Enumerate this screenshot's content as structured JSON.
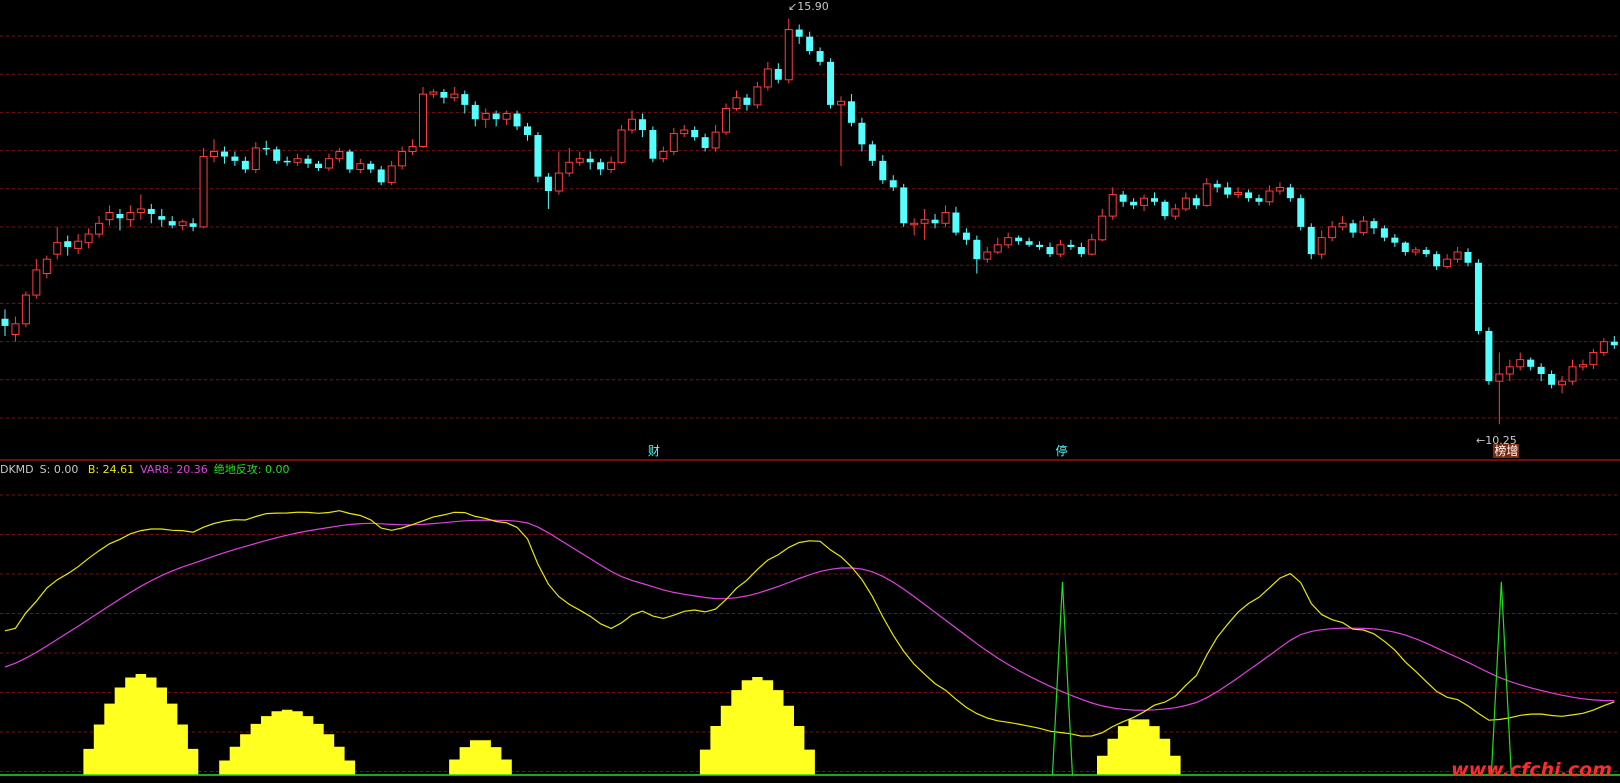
{
  "colors": {
    "background": "#000000",
    "up": "#ff3c3c",
    "down": "#54ffff",
    "grid": "#7a1010",
    "separator": "#a01010",
    "line_b": "#e8e800",
    "line_var8": "#e040e0",
    "signal_green": "#20e020",
    "fill_yellow": "#ffff20"
  },
  "price_panel": {
    "high_label": "15.90",
    "low_label": "10.25",
    "event_tags": [
      {
        "label": "财",
        "bg": "#000000",
        "fg": "#54ffff",
        "index": 62
      },
      {
        "label": "停",
        "bg": "#000000",
        "fg": "#54ffff",
        "index": 101
      },
      {
        "label": "榜增",
        "bg": "#7a2a10",
        "fg": "#ffffff",
        "index": 143
      }
    ],
    "candles": [
      [
        0,
        11.72,
        11.62,
        11.85,
        11.48
      ],
      [
        1,
        11.5,
        11.65,
        11.75,
        11.4
      ],
      [
        2,
        11.65,
        12.05,
        12.1,
        11.6
      ],
      [
        3,
        12.05,
        12.4,
        12.55,
        12.0
      ],
      [
        4,
        12.35,
        12.55,
        12.6,
        12.28
      ],
      [
        5,
        12.62,
        12.78,
        13.0,
        12.55
      ],
      [
        6,
        12.8,
        12.72,
        12.88,
        12.6
      ],
      [
        7,
        12.7,
        12.8,
        12.9,
        12.62
      ],
      [
        8,
        12.78,
        12.9,
        12.98,
        12.7
      ],
      [
        9,
        12.9,
        13.05,
        13.15,
        12.85
      ],
      [
        10,
        13.1,
        13.2,
        13.3,
        13.02
      ],
      [
        11,
        13.18,
        13.12,
        13.25,
        12.95
      ],
      [
        12,
        13.1,
        13.2,
        13.3,
        13.0
      ],
      [
        13,
        13.2,
        13.25,
        13.45,
        13.1
      ],
      [
        14,
        13.25,
        13.18,
        13.32,
        13.05
      ],
      [
        15,
        13.15,
        13.1,
        13.25,
        13.0
      ],
      [
        16,
        13.08,
        13.02,
        13.15,
        12.98
      ],
      [
        17,
        13.02,
        13.07,
        13.1,
        12.95
      ],
      [
        18,
        13.05,
        13.0,
        13.12,
        12.94
      ],
      [
        19,
        13.0,
        13.98,
        14.1,
        12.98
      ],
      [
        20,
        13.98,
        14.05,
        14.22,
        13.9
      ],
      [
        21,
        14.05,
        13.98,
        14.12,
        13.88
      ],
      [
        22,
        13.98,
        13.92,
        14.05,
        13.85
      ],
      [
        23,
        13.92,
        13.8,
        13.98,
        13.75
      ],
      [
        24,
        13.8,
        14.1,
        14.18,
        13.75
      ],
      [
        25,
        14.1,
        14.08,
        14.2,
        14.0
      ],
      [
        26,
        14.08,
        13.92,
        14.12,
        13.88
      ],
      [
        27,
        13.92,
        13.9,
        13.98,
        13.85
      ],
      [
        28,
        13.9,
        13.95,
        14.02,
        13.85
      ],
      [
        29,
        13.95,
        13.88,
        14.0,
        13.82
      ],
      [
        30,
        13.88,
        13.82,
        13.92,
        13.78
      ],
      [
        31,
        13.82,
        13.95,
        14.02,
        13.78
      ],
      [
        32,
        13.95,
        14.05,
        14.1,
        13.9
      ],
      [
        33,
        14.05,
        13.8,
        14.08,
        13.75
      ],
      [
        34,
        13.8,
        13.88,
        13.95,
        13.75
      ],
      [
        35,
        13.88,
        13.8,
        13.92,
        13.75
      ],
      [
        36,
        13.8,
        13.62,
        13.85,
        13.58
      ],
      [
        37,
        13.62,
        13.85,
        13.92,
        13.58
      ],
      [
        38,
        13.85,
        14.05,
        14.12,
        13.8
      ],
      [
        39,
        14.05,
        14.12,
        14.22,
        14.0
      ],
      [
        40,
        14.12,
        14.85,
        14.95,
        14.1
      ],
      [
        41,
        14.85,
        14.88,
        14.92,
        14.8
      ],
      [
        42,
        14.88,
        14.8,
        14.92,
        14.72
      ],
      [
        43,
        14.8,
        14.85,
        14.95,
        14.75
      ],
      [
        44,
        14.85,
        14.7,
        14.9,
        14.58
      ],
      [
        45,
        14.7,
        14.5,
        14.75,
        14.4
      ],
      [
        46,
        14.5,
        14.58,
        14.65,
        14.38
      ],
      [
        47,
        14.58,
        14.5,
        14.62,
        14.4
      ],
      [
        48,
        14.5,
        14.58,
        14.62,
        14.42
      ],
      [
        49,
        14.58,
        14.4,
        14.62,
        14.35
      ],
      [
        50,
        14.4,
        14.28,
        14.45,
        14.2
      ],
      [
        51,
        14.28,
        13.7,
        14.32,
        13.62
      ],
      [
        52,
        13.7,
        13.5,
        13.75,
        13.25
      ],
      [
        53,
        13.5,
        13.75,
        14.05,
        13.45
      ],
      [
        54,
        13.75,
        13.9,
        14.1,
        13.7
      ],
      [
        55,
        13.9,
        13.95,
        14.05,
        13.85
      ],
      [
        56,
        13.95,
        13.9,
        14.05,
        13.8
      ],
      [
        57,
        13.9,
        13.8,
        13.95,
        13.72
      ],
      [
        58,
        13.8,
        13.9,
        13.98,
        13.75
      ],
      [
        59,
        13.9,
        14.35,
        14.42,
        13.88
      ],
      [
        60,
        14.35,
        14.5,
        14.62,
        14.3
      ],
      [
        61,
        14.5,
        14.35,
        14.58,
        14.25
      ],
      [
        62,
        14.35,
        13.95,
        14.4,
        13.9
      ],
      [
        63,
        13.95,
        14.05,
        14.12,
        13.9
      ],
      [
        64,
        14.05,
        14.3,
        14.38,
        14.0
      ],
      [
        65,
        14.3,
        14.35,
        14.42,
        14.25
      ],
      [
        66,
        14.35,
        14.25,
        14.4,
        14.2
      ],
      [
        67,
        14.25,
        14.1,
        14.3,
        14.05
      ],
      [
        68,
        14.1,
        14.32,
        14.42,
        14.05
      ],
      [
        69,
        14.32,
        14.65,
        14.72,
        14.28
      ],
      [
        70,
        14.65,
        14.8,
        14.9,
        14.62
      ],
      [
        71,
        14.8,
        14.7,
        14.85,
        14.62
      ],
      [
        72,
        14.7,
        14.95,
        15.02,
        14.65
      ],
      [
        73,
        14.95,
        15.2,
        15.3,
        14.9
      ],
      [
        74,
        15.2,
        15.05,
        15.28,
        15.0
      ],
      [
        75,
        15.05,
        15.75,
        15.9,
        15.0
      ],
      [
        76,
        15.75,
        15.65,
        15.82,
        15.55
      ],
      [
        77,
        15.65,
        15.45,
        15.72,
        15.4
      ],
      [
        78,
        15.45,
        15.3,
        15.5,
        15.25
      ],
      [
        79,
        15.3,
        14.7,
        15.35,
        14.65
      ],
      [
        80,
        14.7,
        14.75,
        14.82,
        13.85
      ],
      [
        81,
        14.75,
        14.45,
        14.85,
        14.4
      ],
      [
        82,
        14.45,
        14.15,
        14.52,
        14.05
      ],
      [
        83,
        14.15,
        13.92,
        14.2,
        13.85
      ],
      [
        84,
        13.92,
        13.65,
        14.0,
        13.6
      ],
      [
        85,
        13.65,
        13.55,
        13.72,
        13.5
      ],
      [
        86,
        13.55,
        13.05,
        13.6,
        13.0
      ],
      [
        87,
        13.05,
        13.05,
        13.12,
        12.88
      ],
      [
        88,
        13.05,
        13.1,
        13.25,
        12.82
      ],
      [
        89,
        13.1,
        13.05,
        13.18,
        12.98
      ],
      [
        90,
        13.05,
        13.2,
        13.3,
        13.0
      ],
      [
        91,
        13.2,
        12.92,
        13.28,
        12.88
      ],
      [
        92,
        12.92,
        12.82,
        12.98,
        12.75
      ],
      [
        93,
        12.82,
        12.55,
        12.88,
        12.35
      ],
      [
        94,
        12.55,
        12.65,
        12.72,
        12.5
      ],
      [
        95,
        12.65,
        12.75,
        12.85,
        12.62
      ],
      [
        96,
        12.75,
        12.85,
        12.92,
        12.7
      ],
      [
        97,
        12.85,
        12.8,
        12.88,
        12.75
      ],
      [
        98,
        12.8,
        12.75,
        12.85,
        12.72
      ],
      [
        99,
        12.75,
        12.72,
        12.8,
        12.68
      ],
      [
        100,
        12.72,
        12.62,
        12.78,
        12.58
      ],
      [
        101,
        12.62,
        12.75,
        12.82,
        12.58
      ],
      [
        102,
        12.75,
        12.72,
        12.82,
        12.68
      ],
      [
        103,
        12.72,
        12.62,
        12.78,
        12.58
      ],
      [
        104,
        12.62,
        12.82,
        12.9,
        12.6
      ],
      [
        105,
        12.82,
        13.15,
        13.25,
        12.8
      ],
      [
        106,
        13.15,
        13.45,
        13.55,
        13.1
      ],
      [
        107,
        13.45,
        13.35,
        13.5,
        13.28
      ],
      [
        108,
        13.35,
        13.3,
        13.4,
        13.25
      ],
      [
        109,
        13.3,
        13.4,
        13.45,
        13.22
      ],
      [
        110,
        13.4,
        13.35,
        13.48,
        13.3
      ],
      [
        111,
        13.35,
        13.15,
        13.38,
        13.1
      ],
      [
        112,
        13.15,
        13.25,
        13.32,
        13.1
      ],
      [
        113,
        13.25,
        13.4,
        13.48,
        13.22
      ],
      [
        114,
        13.4,
        13.3,
        13.45,
        13.25
      ],
      [
        115,
        13.3,
        13.6,
        13.68,
        13.28
      ],
      [
        116,
        13.6,
        13.55,
        13.65,
        13.48
      ],
      [
        117,
        13.55,
        13.45,
        13.62,
        13.4
      ],
      [
        118,
        13.45,
        13.48,
        13.55,
        13.4
      ],
      [
        119,
        13.48,
        13.4,
        13.52,
        13.35
      ],
      [
        120,
        13.4,
        13.35,
        13.45,
        13.3
      ],
      [
        121,
        13.35,
        13.5,
        13.58,
        13.3
      ],
      [
        122,
        13.5,
        13.55,
        13.62,
        13.45
      ],
      [
        123,
        13.55,
        13.4,
        13.6,
        13.35
      ],
      [
        124,
        13.4,
        13.0,
        13.45,
        12.95
      ],
      [
        125,
        13.0,
        12.62,
        13.05,
        12.55
      ],
      [
        126,
        12.62,
        12.85,
        12.95,
        12.55
      ],
      [
        127,
        12.85,
        13.0,
        13.08,
        12.8
      ],
      [
        128,
        13.0,
        13.05,
        13.15,
        12.95
      ],
      [
        129,
        13.05,
        12.92,
        13.1,
        12.85
      ],
      [
        130,
        12.92,
        13.08,
        13.15,
        12.88
      ],
      [
        131,
        13.08,
        12.98,
        13.12,
        12.9
      ],
      [
        132,
        12.98,
        12.85,
        13.02,
        12.8
      ],
      [
        133,
        12.85,
        12.78,
        12.9,
        12.72
      ],
      [
        134,
        12.78,
        12.65,
        12.8,
        12.6
      ],
      [
        135,
        12.65,
        12.68,
        12.72,
        12.6
      ],
      [
        136,
        12.68,
        12.62,
        12.72,
        12.58
      ],
      [
        137,
        12.62,
        12.45,
        12.66,
        12.4
      ],
      [
        138,
        12.45,
        12.55,
        12.62,
        12.42
      ],
      [
        139,
        12.55,
        12.65,
        12.72,
        12.5
      ],
      [
        140,
        12.65,
        12.5,
        12.7,
        12.45
      ],
      [
        141,
        12.5,
        11.55,
        12.55,
        11.5
      ],
      [
        142,
        11.55,
        10.85,
        11.6,
        10.8
      ],
      [
        143,
        10.85,
        10.95,
        11.25,
        10.25
      ],
      [
        144,
        10.95,
        11.05,
        11.15,
        10.85
      ],
      [
        145,
        11.05,
        11.15,
        11.25,
        11.0
      ],
      [
        146,
        11.15,
        11.05,
        11.18,
        11.0
      ],
      [
        147,
        11.05,
        10.95,
        11.1,
        10.85
      ],
      [
        148,
        10.95,
        10.8,
        11.0,
        10.75
      ],
      [
        149,
        10.8,
        10.85,
        10.92,
        10.68
      ],
      [
        150,
        10.85,
        11.05,
        11.15,
        10.8
      ],
      [
        151,
        11.05,
        11.08,
        11.15,
        11.0
      ],
      [
        152,
        11.08,
        11.25,
        11.3,
        11.02
      ],
      [
        153,
        11.25,
        11.4,
        11.45,
        11.2
      ],
      [
        154,
        11.4,
        11.35,
        11.48,
        11.3
      ]
    ]
  },
  "indicator_panel": {
    "legend": {
      "name": "DKMD",
      "s_label": "S: 0.00",
      "b_label": "B: 24.61",
      "var8_label": "VAR8: 20.36",
      "jdfg_label": "绝地反攻: 0.00"
    }
  },
  "watermark": "www.cfchi.com"
}
